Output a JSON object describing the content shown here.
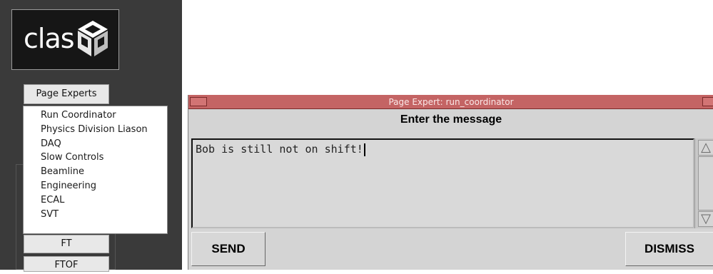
{
  "logo": {
    "text": "clas"
  },
  "side_panel": {
    "page_experts_label": "Page Experts",
    "dropdown_items": [
      "Run Coordinator",
      "Physics Division Liason",
      "DAQ",
      "Slow Controls",
      "Beamline",
      "Engineering",
      "ECAL",
      "SVT"
    ],
    "ft_label": "FT",
    "ftof_label": "FTOF"
  },
  "dialog": {
    "title": "Page Expert: run_coordinator",
    "header": "Enter the message",
    "message": "Bob is still not on shift!",
    "send_label": "SEND",
    "dismiss_label": "DISMISS",
    "scroll_up_icon": "△",
    "scroll_down_icon": "▽"
  },
  "colors": {
    "titlebar": "#c46464",
    "panel": "#3a3a3a",
    "dialog_bg": "#d4d4d4"
  }
}
